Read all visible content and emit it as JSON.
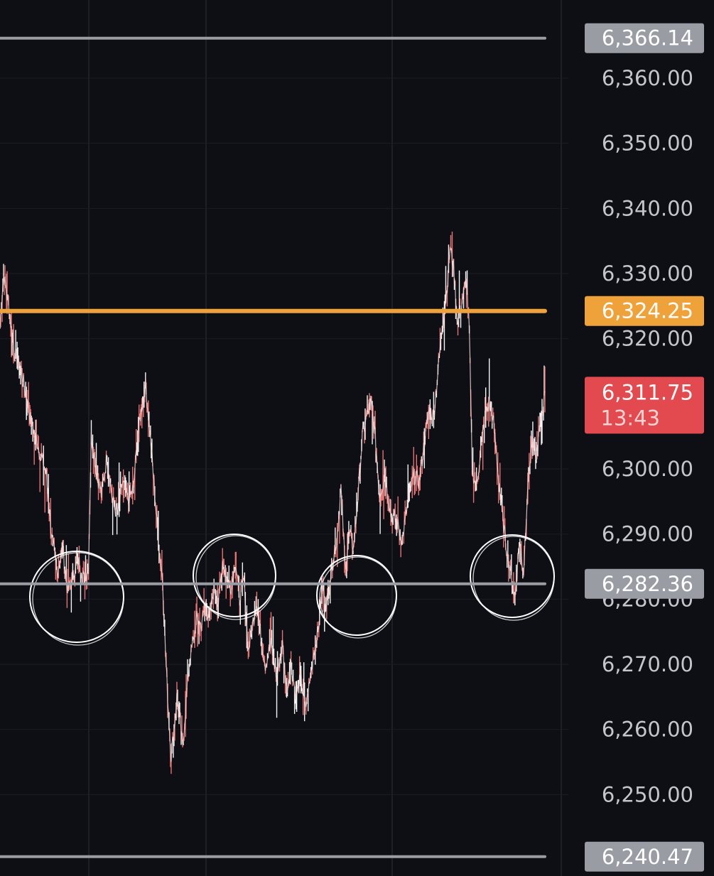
{
  "chart_data": {
    "type": "candlestick",
    "title": "",
    "xlabel": "",
    "ylabel": "",
    "ylim": [
      6237.5,
      6372.0
    ],
    "grid": true,
    "y_ticks": [
      6360.0,
      6350.0,
      6340.0,
      6330.0,
      6320.0,
      6300.0,
      6290.0,
      6280.0,
      6270.0,
      6260.0,
      6250.0
    ],
    "y_tick_labels": [
      "6,360.00",
      "6,350.00",
      "6,340.00",
      "6,330.00",
      "6,320.00",
      "6,300.00",
      "6,290.00",
      "6,280.00",
      "6,270.00",
      "6,260.00",
      "6,250.00"
    ],
    "horizontal_lines": [
      {
        "value": 6366.14,
        "label": "6,366.14",
        "color": "#9a9ca3"
      },
      {
        "value": 6324.25,
        "label": "6,324.25",
        "color": "#f0a23a"
      },
      {
        "value": 6282.36,
        "label": "6,282.36",
        "color": "#9a9ca3"
      },
      {
        "value": 6240.47,
        "label": "6,240.47",
        "color": "#9a9ca3"
      }
    ],
    "last_price": {
      "value": 6311.75,
      "label": "6,311.75",
      "countdown": "13:43",
      "color": "#e24a50"
    },
    "price_path": [
      [
        0,
        6322
      ],
      [
        5,
        6330
      ],
      [
        12,
        6325
      ],
      [
        20,
        6318
      ],
      [
        30,
        6315
      ],
      [
        42,
        6308
      ],
      [
        55,
        6303
      ],
      [
        65,
        6299
      ],
      [
        72,
        6290
      ],
      [
        80,
        6284
      ],
      [
        88,
        6288
      ],
      [
        95,
        6281
      ],
      [
        103,
        6284
      ],
      [
        110,
        6286
      ],
      [
        118,
        6283
      ],
      [
        124,
        6285
      ],
      [
        128,
        6305
      ],
      [
        135,
        6300
      ],
      [
        142,
        6296
      ],
      [
        150,
        6302
      ],
      [
        158,
        6295
      ],
      [
        165,
        6293
      ],
      [
        172,
        6298
      ],
      [
        180,
        6295
      ],
      [
        187,
        6297
      ],
      [
        193,
        6305
      ],
      [
        198,
        6309
      ],
      [
        204,
        6313
      ],
      [
        210,
        6306
      ],
      [
        215,
        6299
      ],
      [
        222,
        6289
      ],
      [
        228,
        6283
      ],
      [
        232,
        6272
      ],
      [
        236,
        6263
      ],
      [
        240,
        6256
      ],
      [
        244,
        6260
      ],
      [
        248,
        6265
      ],
      [
        252,
        6262
      ],
      [
        256,
        6257
      ],
      [
        260,
        6263
      ],
      [
        265,
        6270
      ],
      [
        270,
        6273
      ],
      [
        276,
        6277
      ],
      [
        282,
        6276
      ],
      [
        288,
        6279
      ],
      [
        294,
        6277
      ],
      [
        300,
        6282
      ],
      [
        306,
        6279
      ],
      [
        312,
        6286
      ],
      [
        318,
        6283
      ],
      [
        324,
        6282
      ],
      [
        330,
        6286
      ],
      [
        336,
        6280
      ],
      [
        342,
        6283
      ],
      [
        348,
        6272
      ],
      [
        354,
        6276
      ],
      [
        360,
        6280
      ],
      [
        366,
        6274
      ],
      [
        372,
        6270
      ],
      [
        380,
        6273
      ],
      [
        388,
        6268
      ],
      [
        396,
        6273
      ],
      [
        402,
        6266
      ],
      [
        408,
        6270
      ],
      [
        415,
        6265
      ],
      [
        422,
        6268
      ],
      [
        428,
        6263
      ],
      [
        434,
        6267
      ],
      [
        440,
        6272
      ],
      [
        446,
        6275
      ],
      [
        452,
        6282
      ],
      [
        458,
        6279
      ],
      [
        465,
        6285
      ],
      [
        472,
        6289
      ],
      [
        478,
        6297
      ],
      [
        484,
        6285
      ],
      [
        490,
        6290
      ],
      [
        496,
        6288
      ],
      [
        502,
        6296
      ],
      [
        508,
        6305
      ],
      [
        514,
        6308
      ],
      [
        520,
        6310
      ],
      [
        526,
        6305
      ],
      [
        532,
        6296
      ],
      [
        540,
        6299
      ],
      [
        548,
        6293
      ],
      [
        556,
        6292
      ],
      [
        564,
        6289
      ],
      [
        572,
        6295
      ],
      [
        580,
        6299
      ],
      [
        588,
        6298
      ],
      [
        596,
        6305
      ],
      [
        602,
        6309
      ],
      [
        608,
        6308
      ],
      [
        614,
        6315
      ],
      [
        620,
        6322
      ],
      [
        626,
        6327
      ],
      [
        631,
        6334
      ],
      [
        636,
        6331
      ],
      [
        642,
        6322
      ],
      [
        648,
        6326
      ],
      [
        654,
        6329
      ],
      [
        658,
        6321
      ],
      [
        662,
        6300
      ],
      [
        668,
        6297
      ],
      [
        674,
        6303
      ],
      [
        680,
        6308
      ],
      [
        686,
        6310
      ],
      [
        692,
        6307
      ],
      [
        698,
        6300
      ],
      [
        704,
        6293
      ],
      [
        710,
        6288
      ],
      [
        716,
        6284
      ],
      [
        722,
        6280
      ],
      [
        728,
        6289
      ],
      [
        734,
        6284
      ],
      [
        740,
        6298
      ],
      [
        746,
        6304
      ],
      [
        752,
        6302
      ],
      [
        758,
        6307
      ],
      [
        764,
        6311.75
      ]
    ]
  }
}
